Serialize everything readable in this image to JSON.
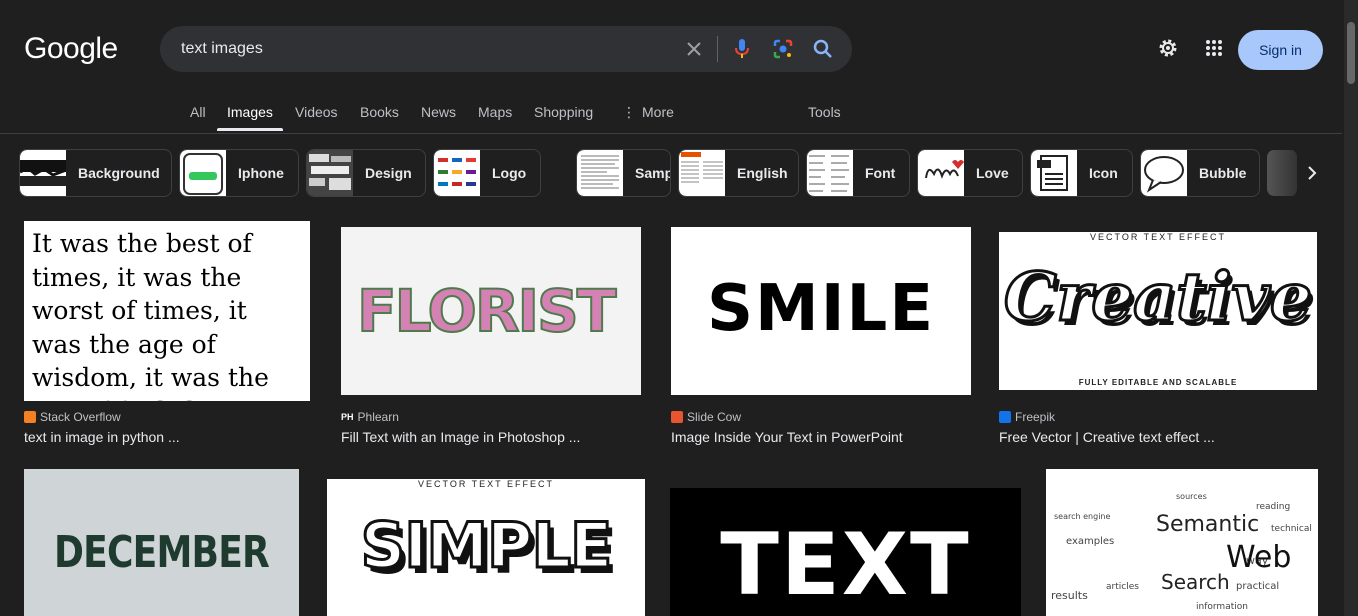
{
  "logo": "Google",
  "search": {
    "query": "text images"
  },
  "header": {
    "signin_label": "Sign in"
  },
  "tabs": [
    {
      "label": "All"
    },
    {
      "label": "Images"
    },
    {
      "label": "Videos"
    },
    {
      "label": "Books"
    },
    {
      "label": "News"
    },
    {
      "label": "Maps"
    },
    {
      "label": "Shopping"
    },
    {
      "label": "More"
    }
  ],
  "tools_label": "Tools",
  "chips": [
    {
      "label": "Background"
    },
    {
      "label": "Iphone"
    },
    {
      "label": "Design"
    },
    {
      "label": "Logo"
    },
    {
      "label": "Sample"
    },
    {
      "label": "English"
    },
    {
      "label": "Font"
    },
    {
      "label": "Love"
    },
    {
      "label": "Icon"
    },
    {
      "label": "Bubble"
    }
  ],
  "results": [
    {
      "source": "Stack Overflow",
      "title": "text in image in python ...",
      "favicon_color": "#f48024",
      "image_text": "It was the best of times, it was the worst of times, it was the age of wisdom, it was the age of foolishness..."
    },
    {
      "source": "Phlearn",
      "title": "Fill Text with an Image in Photoshop ...",
      "favicon_color": "#ffffff",
      "image_text": "FLORIST"
    },
    {
      "source": "Slide Cow",
      "title": "Image Inside Your Text in PowerPoint",
      "favicon_color": "#e8552f",
      "image_text": "SMILE"
    },
    {
      "source": "Freepik",
      "title": "Free Vector | Creative text effect ...",
      "favicon_color": "#1273eb",
      "image_text": "Creative",
      "image_top": "VECTOR TEXT EFFECT",
      "image_bottom": "FULLY EDITABLE AND SCALABLE"
    },
    {
      "image_text": "DECEMBER"
    },
    {
      "image_text": "SIMPLE",
      "image_top": "VECTOR TEXT EFFECT"
    },
    {
      "image_text": "TEXT"
    },
    {
      "image_text": "Semantic Web Search"
    }
  ],
  "colors": {
    "background": "#1f1f1f",
    "accent": "#a8c7fa",
    "search_bg": "#303134"
  }
}
